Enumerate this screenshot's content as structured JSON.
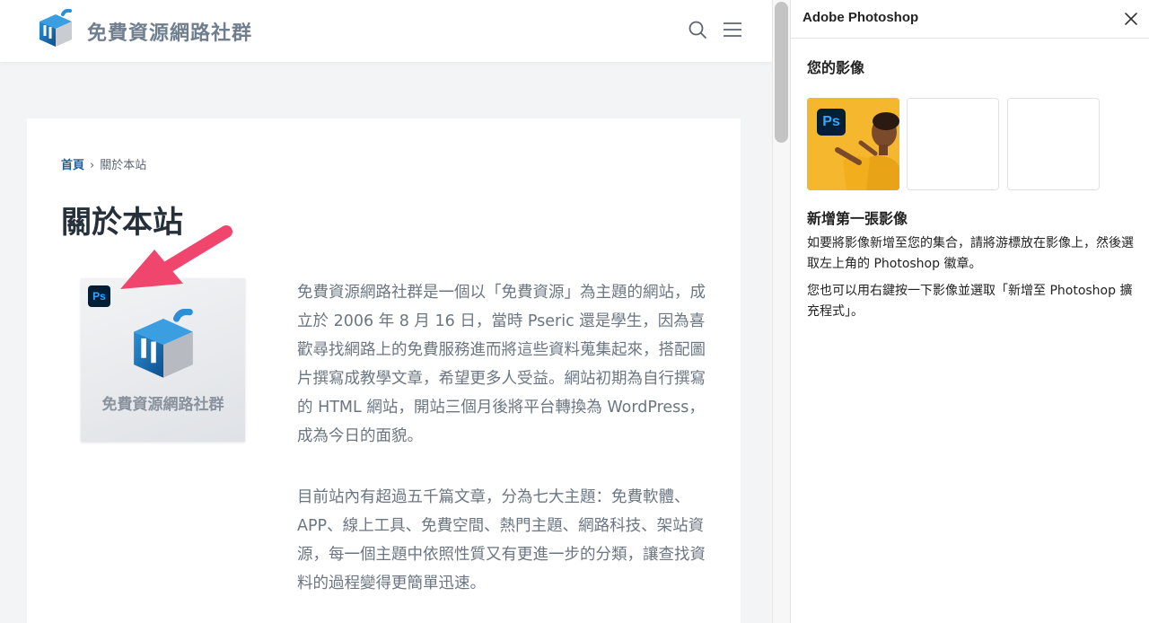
{
  "site": {
    "title": "免費資源網路社群",
    "breadcrumb": {
      "home": "首頁",
      "separator": "›",
      "current": "關於本站"
    },
    "page_title": "關於本站",
    "thumbnail": {
      "badge": "Ps",
      "caption": "免費資源網路社群"
    },
    "paragraphs": [
      "免費資源網路社群是一個以「免費資源」為主題的網站，成立於 2006 年 8 月 16 日，當時 Pseric 還是學生，因為喜歡尋找網路上的免費服務進而將這些資料蒐集起來，搭配圖片撰寫成教學文章，希望更多人受益。網站初期為自行撰寫的 HTML 網站，開站三個月後將平台轉換為 WordPress，成為今日的面貌。",
      "目前站內有超過五千篇文章，分為七大主題：免費軟體、APP、線上工具、免費空間、熱門主題、網路科技、架站資源，每一個主題中依照性質又有更進一步的分類，讓查找資料的過程變得更簡單迅速。"
    ],
    "icons": {
      "search": "search-icon",
      "menu": "hamburger-menu-icon"
    },
    "colors": {
      "accent": "#1f5f9a",
      "arrow": "#f0456d",
      "ps_bg": "#001e36",
      "ps_text": "#31a8ff"
    }
  },
  "panel": {
    "title": "Adobe Photoshop",
    "your_images": "您的影像",
    "slot_badge": "Ps",
    "add_first_title": "新增第一張影像",
    "desc1": "如要將影像新增至您的集合，請將游標放在影像上，然後選取左上角的 Photoshop 徽章。",
    "desc2": "您也可以用右鍵按一下影像並選取「新增至 Photoshop 擴充程式」。"
  }
}
